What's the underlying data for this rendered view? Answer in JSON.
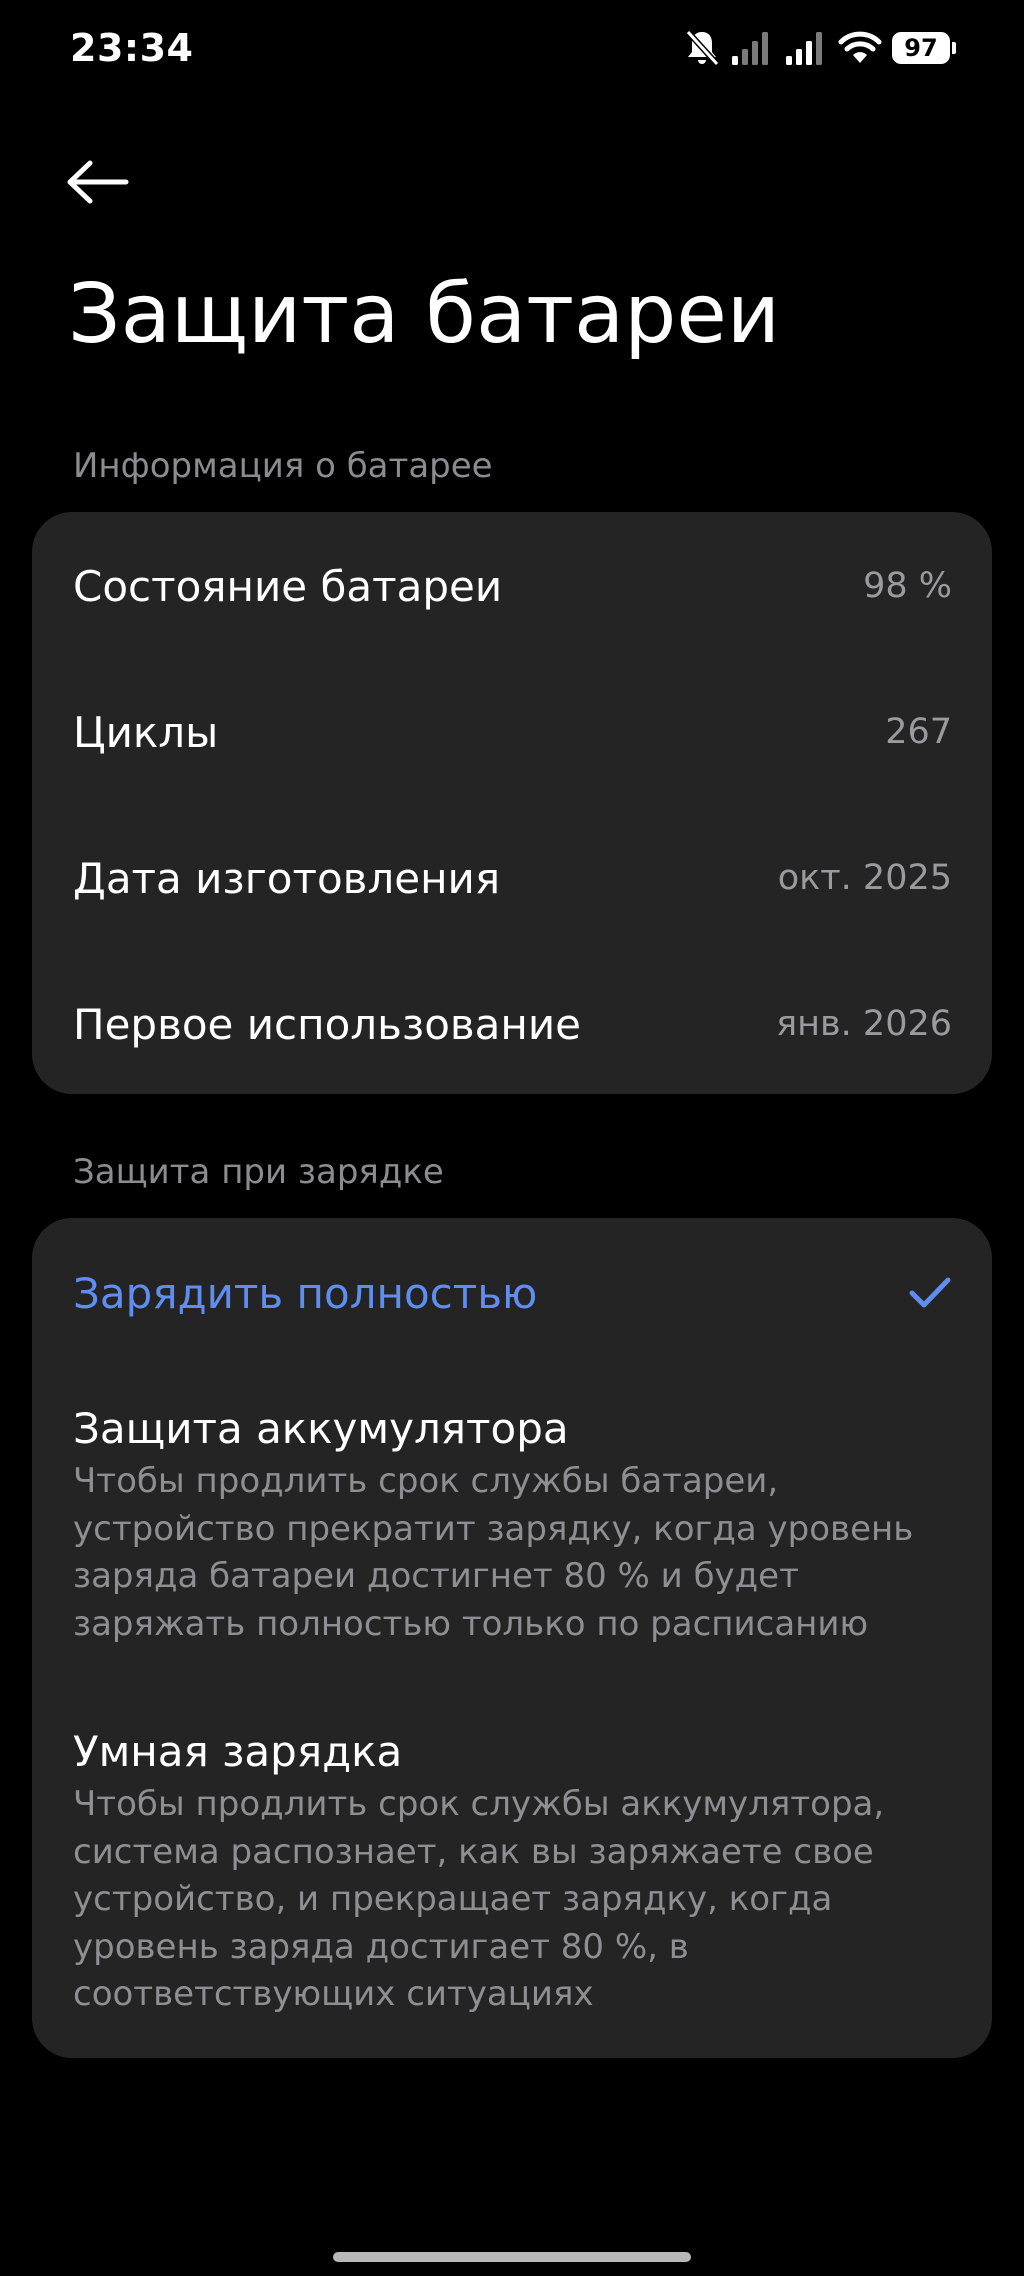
{
  "status_bar": {
    "time": "23:34",
    "battery_level": "97",
    "icons": [
      "bell-off-icon",
      "signal-icon",
      "signal-icon",
      "wifi-icon",
      "battery-icon"
    ]
  },
  "header": {
    "back_icon": "arrow-left-icon",
    "title": "Защита батареи"
  },
  "battery_info": {
    "section_title": "Информация о батарее",
    "rows": [
      {
        "label": "Состояние батареи",
        "value": "98 %"
      },
      {
        "label": "Циклы",
        "value": "267"
      },
      {
        "label": "Дата изготовления",
        "value": "окт. 2025"
      },
      {
        "label": "Первое использование",
        "value": "янв. 2026"
      }
    ]
  },
  "charging_protection": {
    "section_title": "Защита при зарядке",
    "selected_option": {
      "label": "Зарядить полностью",
      "icon": "check-icon"
    },
    "options": [
      {
        "title": "Защита аккумулятора",
        "description": "Чтобы продлить срок службы батареи, устройство прекратит зарядку, когда уровень заряда батареи достигнет 80 % и будет заряжать полностью только по расписанию"
      },
      {
        "title": "Умная зарядка",
        "description": "Чтобы продлить срок службы аккумулятора, система распознает, как вы заряжаете свое устройство, и прекращает зарядку, когда уровень заряда достигает 80 %, в соответствующих ситуациях"
      }
    ]
  },
  "colors": {
    "background": "#000000",
    "card": "#242424",
    "accent": "#5f8ef0",
    "secondary_text": "#8e8e93"
  }
}
